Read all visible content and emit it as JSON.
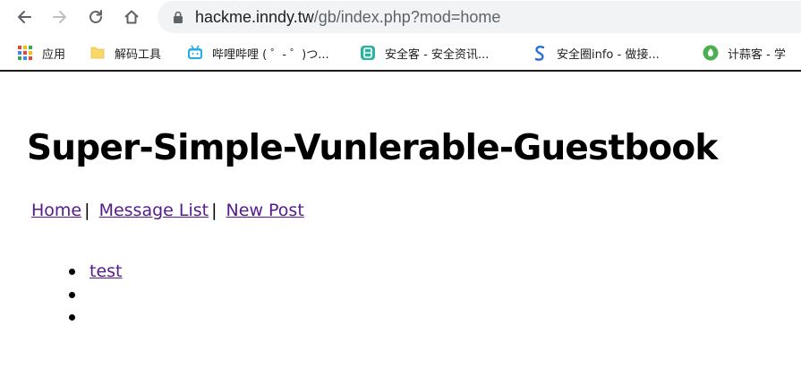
{
  "browser": {
    "url_host": "hackme.inndy.tw",
    "url_rest": "/gb/index.php?mod=home",
    "bookmarks": [
      {
        "label": "应用",
        "icon": "apps-grid-icon"
      },
      {
        "label": "解码工具",
        "icon": "folder-icon"
      },
      {
        "label": "哔哩哔哩 ( ゜- ゜)つ...",
        "icon": "bilibili-icon"
      },
      {
        "label": "安全客 - 安全资讯...",
        "icon": "anquanke-icon"
      },
      {
        "label": "安全圈info - 做接...",
        "icon": "anquanquan-icon"
      },
      {
        "label": "计蒜客 - 学",
        "icon": "jisuanke-icon"
      }
    ]
  },
  "page": {
    "title": "Super-Simple-Vunlerable-Guestbook",
    "nav": {
      "home": "Home",
      "sep1": "|",
      "message_list": "Message List",
      "sep2": "|",
      "new_post": "New Post"
    },
    "messages": [
      "test",
      "",
      ""
    ]
  }
}
